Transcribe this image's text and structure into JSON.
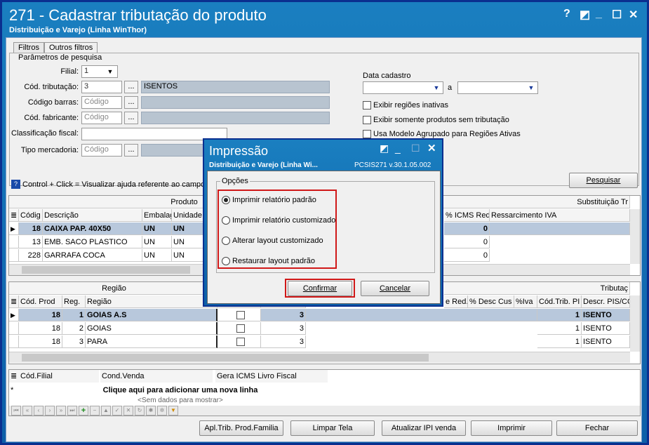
{
  "window": {
    "title": "271 - Cadastrar tributação do produto",
    "subtitle": "Distribuição e Varejo (Linha WinThor)",
    "controls": [
      "?",
      "◩",
      "_",
      "☐",
      "✕"
    ]
  },
  "tabs": [
    "Filtros",
    "Outros filtros"
  ],
  "filters": {
    "group_label": "Parâmetros de pesquisa",
    "filial_label": "Filial:",
    "filial_value": "1",
    "cod_trib_label": "Cód. tributação:",
    "cod_trib_value": "3",
    "cod_trib_desc": "ISENTOS",
    "codigo_barras_label": "Código barras:",
    "codigo_barras_placeholder": "Código",
    "cod_fabricante_label": "Cód. fabricante:",
    "cod_fabricante_placeholder": "Código",
    "classificacao_label": "Classificação fiscal:",
    "tipo_mercadoria_label": "Tipo mercadoria:",
    "tipo_mercadoria_placeholder": "Código",
    "dots": "...",
    "data_cadastro_label": "Data cadastro",
    "a_label": "a",
    "chk_regioes_inativas": "Exibir regiões inativas",
    "chk_sem_tributacao": "Exibir somente produtos sem tributação",
    "chk_modelo_agrupado": "Usa Modelo Agrupado para Regiões Ativas"
  },
  "help_text": "Control + Click = Visualizar ajuda referente ao campo",
  "pesquisar_label": "Pesquisar",
  "produto_grid": {
    "group_produto": "Produto",
    "group_subst": "Substituição Tr",
    "headers": [
      "Códig",
      "Descrição",
      "Embalag",
      "Unidade",
      "% ICMS Red.",
      "Ressarcimento IVA"
    ],
    "rows": [
      {
        "cod": "18",
        "desc": "CAIXA PAP. 40X50",
        "emb": "UN",
        "und": "UN",
        "icms": "0"
      },
      {
        "cod": "13",
        "desc": "EMB. SACO PLASTICO",
        "emb": "UN",
        "und": "UN",
        "icms": "0"
      },
      {
        "cod": "228",
        "desc": "GARRAFA COCA",
        "emb": "UN",
        "und": "UN",
        "icms": "0"
      }
    ]
  },
  "regiao_grid": {
    "group_regiao": "Região",
    "group_trib": "Tributaç",
    "headers": [
      "Cód. Prod",
      "Reg.",
      "Região",
      "e Red.",
      "% Desc Cus",
      "%Iva",
      "Cód.Trib. PI",
      "Descr. PIS/CO"
    ],
    "rows": [
      {
        "cod": "18",
        "reg": "1",
        "regiao": "GOIAS A.S",
        "val": "3",
        "trib": "1",
        "descr": "ISENTO"
      },
      {
        "cod": "18",
        "reg": "2",
        "regiao": "GOIAS",
        "val": "3",
        "trib": "1",
        "descr": "ISENTO"
      },
      {
        "cod": "18",
        "reg": "3",
        "regiao": "PARA",
        "val": "3",
        "trib": "1",
        "descr": "ISENTO"
      }
    ]
  },
  "filial_grid": {
    "headers": [
      "Cód.Filial",
      "Cond.Venda",
      "Gera ICMS Livro Fiscal"
    ],
    "new_row": "Clique aqui para adicionar uma nova linha",
    "empty": "<Sem dados para mostrar>"
  },
  "footer_buttons": [
    "Apl.Trib. Prod.Familia",
    "Limpar Tela",
    "Atualizar IPI venda",
    "Imprimir",
    "Fechar"
  ],
  "modal": {
    "title": "Impressão",
    "subtitle": "Distribuição e Varejo (Linha Wi...",
    "version": "PCSIS271  v.30.1.05.002",
    "group_label": "Opções",
    "options": [
      "Imprimir relatório padrão",
      "Imprimir relatório customizado",
      "Alterar layout customizado",
      "Restaurar layout padrão"
    ],
    "selected_option": "Imprimir relatório padrão",
    "confirm": "Confirmar",
    "cancel": "Cancelar"
  },
  "colors": {
    "title_bar": "#0d5fa8",
    "highlight_red": "#d01818",
    "selected_row": "#b8c8dc",
    "readonly_field": "#b8c4d0"
  }
}
